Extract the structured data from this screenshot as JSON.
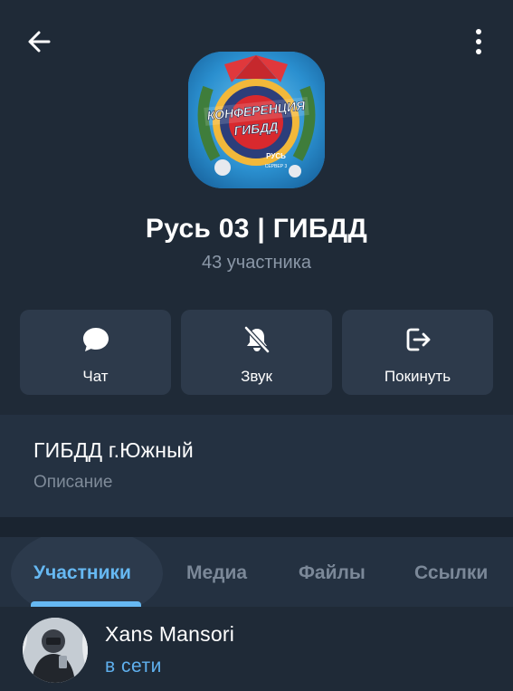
{
  "header": {
    "back_icon": "arrow-left-icon",
    "menu_icon": "more-vertical-icon"
  },
  "group": {
    "title": "Русь 03 | ГИБДД",
    "members_count": "43 участника",
    "avatar_text": {
      "line1": "КОНФЕРЕНЦИЯ",
      "line2": "ГИБДД",
      "brand": "РУСЬ",
      "server": "СЕРВЕР 3"
    }
  },
  "actions": [
    {
      "label": "Чат",
      "icon": "chat-bubble-icon"
    },
    {
      "label": "Звук",
      "icon": "bell-off-icon"
    },
    {
      "label": "Покинуть",
      "icon": "leave-icon"
    }
  ],
  "info": {
    "title": "ГИБДД г.Южный",
    "subtitle": "Описание"
  },
  "tabs": [
    {
      "label": "Участники",
      "active": true
    },
    {
      "label": "Медиа",
      "active": false
    },
    {
      "label": "Файлы",
      "active": false
    },
    {
      "label": "Ссылки",
      "active": false
    }
  ],
  "members": [
    {
      "name": "Xans Mansori",
      "status": "в сети"
    }
  ],
  "colors": {
    "background": "#1f2a37",
    "card": "#2d3a4b",
    "accent": "#66b8f2",
    "muted": "#8b98a8"
  }
}
